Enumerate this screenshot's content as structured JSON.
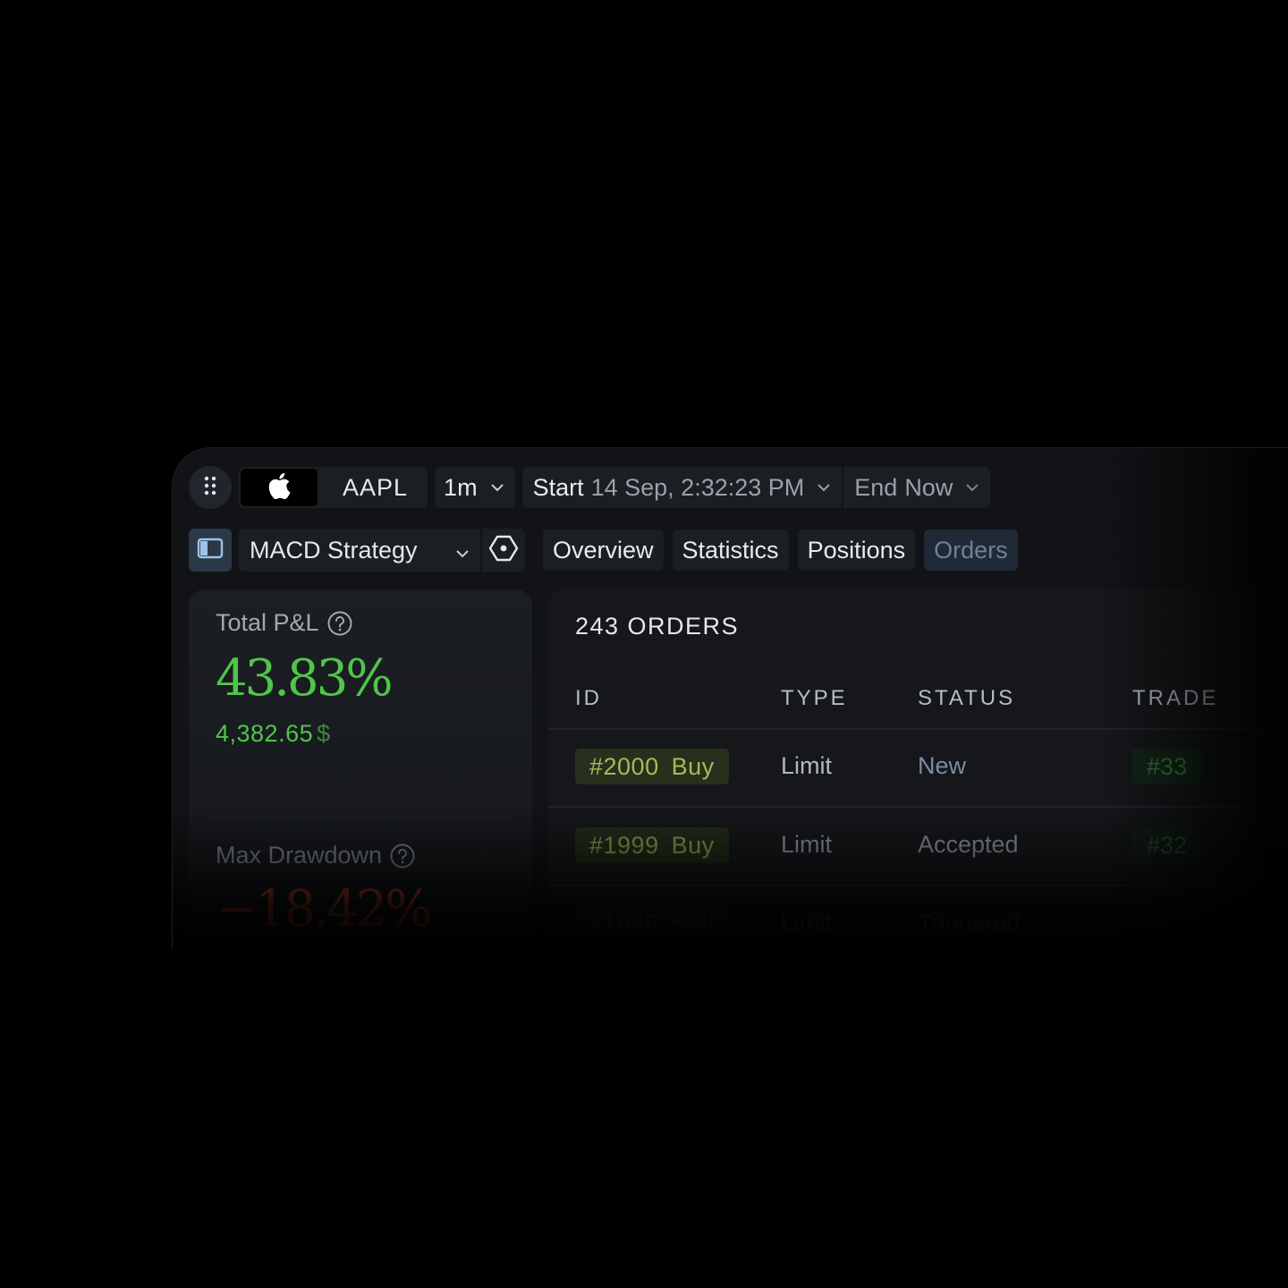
{
  "toolbar": {
    "symbol": "AAPL",
    "interval": "1m",
    "start_label": "Start",
    "start_value": "14 Sep, 2:32:23 PM",
    "end_label": "End",
    "end_value": "Now"
  },
  "strategy": {
    "name": "MACD Strategy"
  },
  "tabs": [
    {
      "label": "Overview"
    },
    {
      "label": "Statistics"
    },
    {
      "label": "Positions"
    },
    {
      "label": "Orders",
      "active": true
    }
  ],
  "metrics": {
    "total_pnl": {
      "label": "Total P&L",
      "percent": "43.83%",
      "amount": "4,382.65",
      "currency": "$"
    },
    "max_drawdown": {
      "label": "Max Drawdown",
      "percent": "−18.42%"
    }
  },
  "orders": {
    "title": "243 ORDERS",
    "columns": [
      "ID",
      "TYPE",
      "STATUS",
      "TRADE"
    ],
    "rows": [
      {
        "id": "#2000",
        "side": "Buy",
        "type": "Limit",
        "status": "New",
        "trade": "#33"
      },
      {
        "id": "#1999",
        "side": "Buy",
        "type": "Limit",
        "status": "Accepted",
        "trade": "#32"
      },
      {
        "id": "#1998",
        "side": "Sell",
        "type": "Limit",
        "status": "Triggered",
        "trade": ""
      }
    ]
  },
  "colors": {
    "profit": "#4fc54a",
    "loss": "#c6452c",
    "status_new": "#7a8ca3",
    "buy_badge_bg": "#27301c",
    "buy_badge_fg": "#a3bb5a",
    "active_tab_bg": "#1f2a36"
  },
  "icons": {
    "menu": "grid-dots-icon",
    "symbol": "apple-logo-icon",
    "dropdown": "chevron-down-icon",
    "sidebar": "sidebar-panel-icon",
    "strategy_settings": "hexagon-settings-icon",
    "help": "question-circle-icon"
  }
}
